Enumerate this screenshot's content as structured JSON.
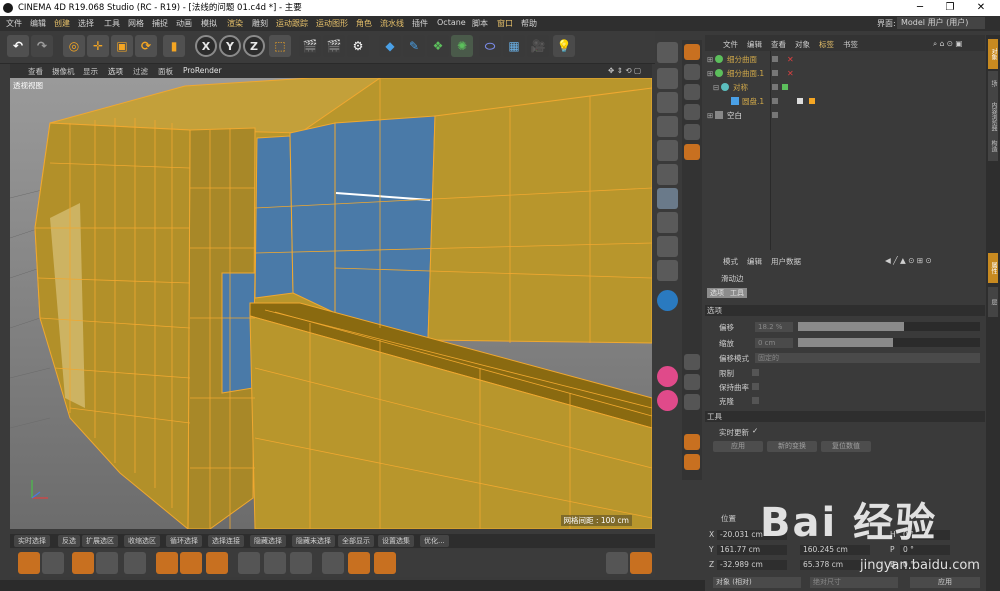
{
  "window": {
    "title": "CINEMA 4D R19.068 Studio (RC - R19) - [法线的问题 01.c4d *] - 主要",
    "interface_label": "界面:",
    "interface_value": "Model 用户 (用户)"
  },
  "menu": [
    "文件",
    "编辑",
    "创建",
    "选择",
    "工具",
    "网格",
    "捕捉",
    "动画",
    "模拟",
    "渲染",
    "雕刻",
    "运动跟踪",
    "运动图形",
    "角色",
    "流水线",
    "插件",
    "Octane",
    "脚本",
    "窗口",
    "帮助"
  ],
  "toolbar": {
    "axis_x": "X",
    "axis_y": "Y",
    "axis_z": "Z"
  },
  "viewport": {
    "menu": [
      "查看",
      "摄像机",
      "显示",
      "选项",
      "过滤",
      "面板",
      "ProRender"
    ],
    "label": "透视视图",
    "grid_spacing": "网格间距 : 100 cm"
  },
  "selection_bar": [
    "实时选择",
    "反选",
    "扩展选区",
    "收缩选区",
    "循环选择",
    "选择连接",
    "隐藏选择",
    "隐藏未选择",
    "全部显示",
    "设置选集",
    "优化..."
  ],
  "object_manager": {
    "menu": [
      "文件",
      "编辑",
      "查看",
      "对象",
      "标签",
      "书签"
    ],
    "objects": [
      {
        "name": "细分曲面",
        "color": "#d0a84a"
      },
      {
        "name": "细分曲面.1",
        "color": "#d0a84a"
      },
      {
        "name": "对称",
        "color": "#d0a84a"
      },
      {
        "name": "圆盘.1",
        "color": "#d0a84a"
      },
      {
        "name": "空白",
        "color": "#e0e0e0"
      }
    ]
  },
  "attribute_manager": {
    "menu": [
      "模式",
      "编辑",
      "用户数据"
    ],
    "tool_name": "滑动边",
    "tabs": [
      "选项",
      "工具"
    ],
    "section_options": "选项",
    "offset_label": "偏移",
    "offset_value": "18.2 %",
    "offset_slider": 0.58,
    "scale_label": "缩放",
    "scale_value": "0 cm",
    "scale_slider": 0.52,
    "offset_mode_label": "偏移模式",
    "offset_mode_value": "固定的",
    "limit_label": "限制",
    "keep_curve_label": "保持曲率",
    "clone_label": "克隆",
    "section_tool": "工具",
    "realtime_label": "实时更新",
    "realtime_check": "✓",
    "btn_apply": "应用",
    "btn_new": "新的变换",
    "btn_reset": "复位数值"
  },
  "coordinates": {
    "header": "位置",
    "x_label": "X",
    "x_value": "-20.031 cm",
    "y_label": "Y",
    "y_value": "161.77 cm",
    "z_label": "Z",
    "z_value": "-32.989 cm",
    "size_y": "160.245 cm",
    "size_z": "65.378 cm",
    "h_label": "H",
    "h_value": "0 °",
    "p_label": "P",
    "p_value": "0 °",
    "b_label": "B",
    "b_value": "0 °",
    "mode": "对象 (相对)",
    "size_mode": "绝对尺寸",
    "apply": "应用"
  },
  "right_tabs": [
    "对象",
    "场次",
    "内容浏览器",
    "构造",
    "属性",
    "层"
  ],
  "watermark": {
    "main": "Bai 经验",
    "url": "jingyan.baidu.com"
  },
  "colors": {
    "accent": "#f5a623",
    "model_fill": "#b8962c",
    "model_edge": "#f0a830",
    "selected_poly": "#4a7aa8"
  }
}
